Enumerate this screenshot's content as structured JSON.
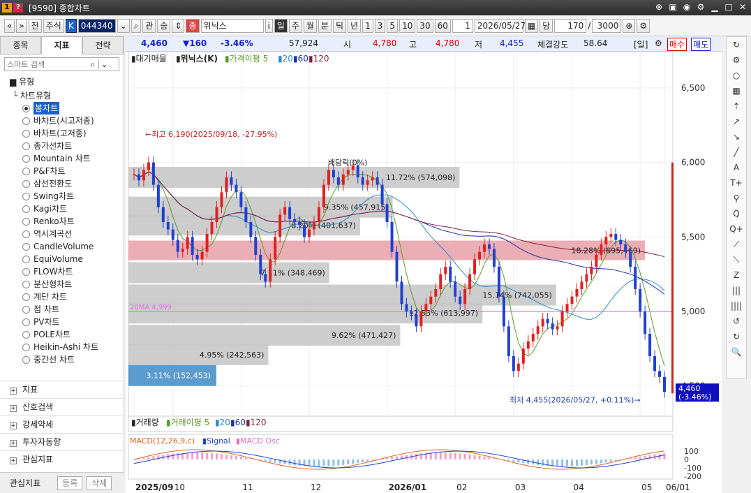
{
  "window": {
    "title_num": "1",
    "title_q": "?",
    "title": "[9590] 종합차트"
  },
  "toolbar": {
    "back": "«",
    "down": "»",
    "prev_btn": "전",
    "market": "주식",
    "k_badge": "K",
    "code": "044340",
    "search": "⌕",
    "btn_gwan": "관",
    "btn_seung": "승",
    "jong_badge": "종",
    "stock_name": "위닉스",
    "info_btn": "i",
    "periods": [
      "일",
      "주",
      "월",
      "분",
      "틱",
      "년"
    ],
    "intervals": [
      "1",
      "3",
      "5",
      "10",
      "30",
      "60"
    ],
    "count_value": "1",
    "date": "2026/05/27",
    "dang": "당",
    "bars": "170",
    "slash": "/",
    "total": "3000"
  },
  "left": {
    "tabs": [
      "종목",
      "지표",
      "전략"
    ],
    "search_placeholder": "스마트 검색",
    "section_type": "유형",
    "tree_group": "차트유형",
    "chart_types": [
      "봉차트",
      "바차트(시고저종)",
      "바차트(고저종)",
      "종가선차트",
      "Mountain 차트",
      "P&F차트",
      "삼선전환도",
      "Swing차트",
      "Kagi차트",
      "Renko차트",
      "역시계곡선",
      "CandleVolume",
      "EquiVolume",
      "FLOW차트",
      "분산형차트",
      "계단 차트",
      "점 차트",
      "PV차트",
      "POLE차트",
      "Heikin-Ashi 차트",
      "중간선 차트"
    ],
    "selected_index": 0,
    "sections": [
      "지표",
      "신호검색",
      "강세약세",
      "투자자동향",
      "관심지표"
    ],
    "fav_label": "관심지표",
    "fav_add": "등록",
    "fav_del": "삭제"
  },
  "quote": {
    "price": "4,460",
    "change": "▼160",
    "pct": "-3.46%",
    "volume": "57,924",
    "open_label": "시",
    "open": "4,780",
    "high_label": "고",
    "high": "4,780",
    "low_label": "저",
    "low": "4,455",
    "strength_label": "체결강도",
    "strength": "58.64",
    "period_tag": "[일]",
    "buy": "매수",
    "sell": "매도"
  },
  "chart_data": {
    "type": "candlestick",
    "title": "위닉스(K)",
    "legend": {
      "vol_profile": "대기매물",
      "name": "위닉스(K)",
      "ma_label": "가격이평 5",
      "ma": [
        "20",
        "60",
        "120"
      ]
    },
    "y_ticks": [
      "6,500",
      "6,000",
      "5,500",
      "5,000",
      "4,500"
    ],
    "ylim": [
      4450,
      6500
    ],
    "x_ticks": [
      "2025/09",
      "10",
      "11",
      "12",
      "2026/01",
      "02",
      "03",
      "04",
      "05",
      "06/01"
    ],
    "current_price": "4,460",
    "current_pct": "(-3.46%)",
    "annotations": {
      "high": "최고 6,190(2025/09/18, -27.95%)",
      "low": "최저 4,455(2026/05/27, +0.11%)",
      "dividend": "배당락(0%)",
      "ma_line": "20MA 4,999"
    },
    "volume_profile": [
      {
        "label": "11.72% (574,098)",
        "pct": 11.72,
        "price": 5900
      },
      {
        "label": "9.35% (457,915)",
        "pct": 9.35,
        "price": 5700
      },
      {
        "label": "8.20% (401,637)",
        "pct": 8.2,
        "price": 5580
      },
      {
        "label": "18.28% (895,469)",
        "pct": 18.28,
        "price": 5410,
        "highlight": true
      },
      {
        "label": "7.11% (348,469)",
        "pct": 7.11,
        "price": 5260
      },
      {
        "label": "15.14% (742,055)",
        "pct": 15.14,
        "price": 5110
      },
      {
        "label": "12.53% (613,997)",
        "pct": 12.53,
        "price": 4990
      },
      {
        "label": "9.62% (471,427)",
        "pct": 9.62,
        "price": 4840
      },
      {
        "label": "4.95% (242,563)",
        "pct": 4.95,
        "price": 4710
      },
      {
        "label": "3.11% (152,453)",
        "pct": 3.11,
        "price": 4570,
        "current": true
      }
    ],
    "close": [
      5920,
      5880,
      5950,
      6000,
      5850,
      5700,
      5600,
      5550,
      5480,
      5400,
      5420,
      5500,
      5380,
      5350,
      5400,
      5520,
      5600,
      5700,
      5800,
      5900,
      5850,
      5800,
      5700,
      5600,
      5500,
      5380,
      5250,
      5200,
      5350,
      5500,
      5650,
      5700,
      5620,
      5600,
      5580,
      5500,
      5550,
      5600,
      5700,
      5850,
      5950,
      5900,
      5850,
      5920,
      5950,
      5980,
      5900,
      5850,
      5880,
      5900,
      5850,
      5720,
      5600,
      5400,
      5200,
      5050,
      5000,
      4980,
      4900,
      5000,
      5050,
      5100,
      5150,
      5250,
      5300,
      5200,
      5100,
      5050,
      5150,
      5250,
      5350,
      5400,
      5450,
      5420,
      5300,
      5100,
      4900,
      4700,
      4600,
      4650,
      4750,
      4800,
      4850,
      4900,
      4950,
      4920,
      4880,
      4900,
      5000,
      5050,
      5100,
      5150,
      5200,
      5250,
      5300,
      5380,
      5450,
      5500,
      5520,
      5480,
      5450,
      5400,
      5300,
      5150,
      5000,
      4850,
      4700,
      4600,
      4560,
      4460
    ],
    "ma": {
      "20": 5000,
      "60": 5200,
      "120": 5220
    },
    "volume_panel": {
      "label": "거래량",
      "ma_label": "거래이평 5",
      "ma": [
        "20",
        "60",
        "120"
      ]
    },
    "macd_panel": {
      "label": "MACD(12,26,9,c)",
      "signal": "Signal",
      "osc": "MACD Osc",
      "y_ticks": [
        "100",
        "0",
        "-100",
        "-200"
      ]
    }
  },
  "rtools": [
    "↻",
    "⚙",
    "○",
    "▦",
    "⇡",
    "↗",
    "↘",
    "╱",
    "A",
    "T+",
    "⚲",
    "Q",
    "Q+",
    "⟋",
    "⟍",
    "Z",
    "|||",
    "||||",
    "↺",
    "↻",
    "🔍"
  ]
}
